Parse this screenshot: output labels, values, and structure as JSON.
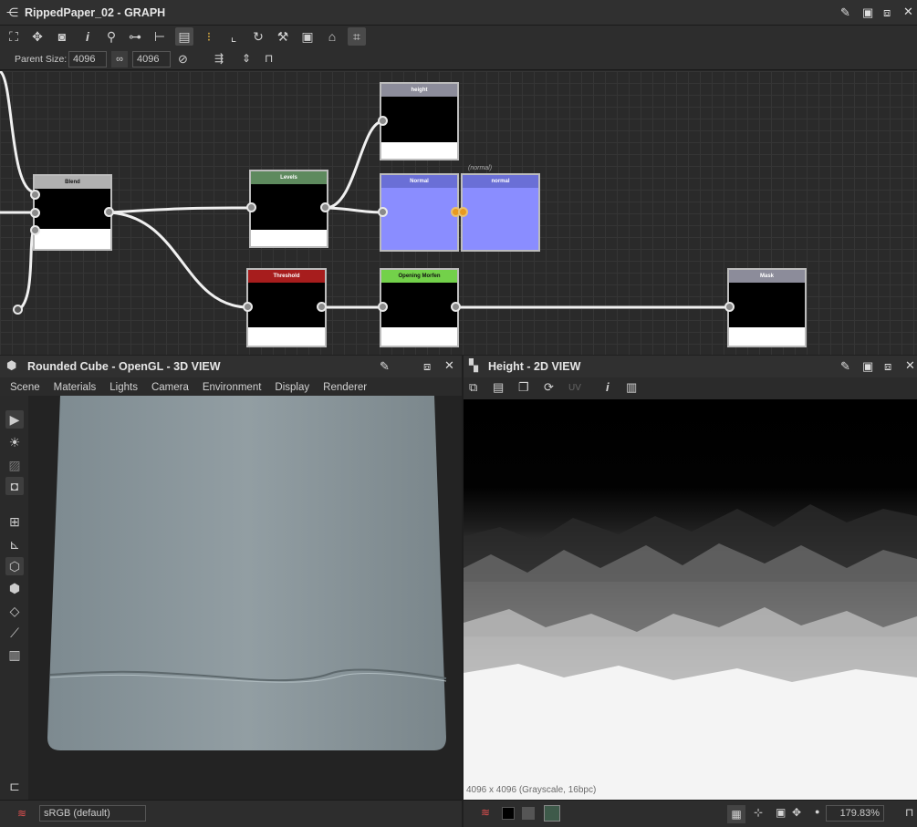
{
  "graph": {
    "title": "RippedPaper_02 - GRAPH",
    "parent_size_label": "Parent Size:",
    "parent_size_w": "4096",
    "parent_size_h": "4096",
    "nodes": {
      "blend": "Blend",
      "levels": "Levels",
      "threshold": "Threshold",
      "opening": "Opening Morfen",
      "height": "height",
      "normal": "Normal",
      "normal_out": "normal",
      "normal_tag": "(normal)",
      "mask": "Mask"
    }
  },
  "view3d": {
    "title": "Rounded Cube - OpenGL - 3D VIEW",
    "menu": [
      "Scene",
      "Materials",
      "Lights",
      "Camera",
      "Environment",
      "Display",
      "Renderer"
    ],
    "colorspace": "sRGB (default)"
  },
  "view2d": {
    "title": "Height - 2D VIEW",
    "uv_label": "UV",
    "info": "4096 x 4096 (Grayscale, 16bpc)",
    "zoom": "179.83%"
  },
  "icons": [
    "graph-icon",
    "pin-icon",
    "maximize-icon",
    "restore-icon",
    "close-icon",
    "cube-icon",
    "checker-icon",
    "camera-icon",
    "bulb-icon",
    "histogram-icon",
    "layers-icon",
    "link-icon",
    "reset-icon"
  ],
  "colors": {
    "levels": "#5e8a5e",
    "threshold": "#a71d1d",
    "opening": "#73d14a",
    "normal": "#6a6fd6",
    "normal_fill": "#8a8dff",
    "gray_header": "#8c8c9a",
    "blend": "#b0b0b0"
  }
}
